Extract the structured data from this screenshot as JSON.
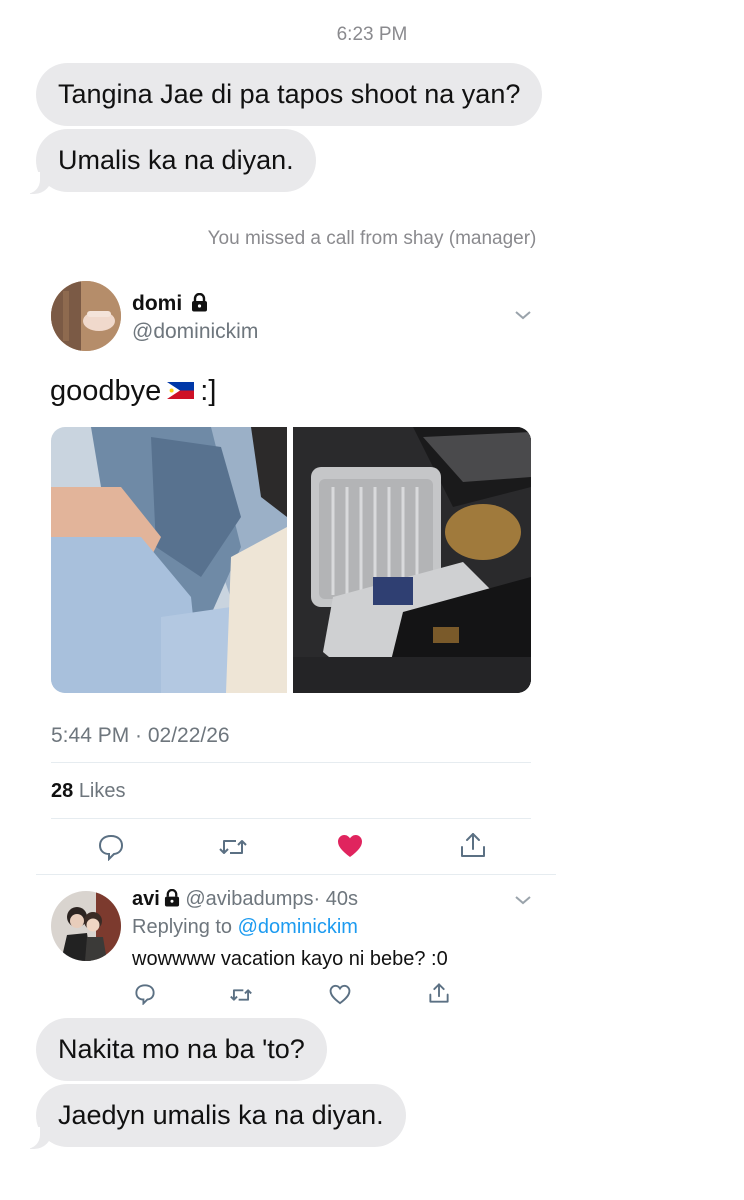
{
  "thread_top": {
    "time": "6:23 PM",
    "messages": [
      "Tangina Jae di pa tapos shoot na yan?",
      "Umalis ka na diyan."
    ],
    "missed_call": "You missed a call from shay (manager)"
  },
  "tweet": {
    "display_name": "domi",
    "handle": "@dominickim",
    "text": "goodbye",
    "text_after_flag": ":]",
    "flag_icon": "philippines-flag-icon",
    "datetime": "5:44 PM · 02/22/26",
    "likes_count": "28",
    "likes_label": "Likes",
    "liked": true,
    "like_color": "#e0245e"
  },
  "reply": {
    "display_name": "avi",
    "handle": "@avibadumps",
    "age": "· 40s",
    "replying_prefix": "Replying to",
    "replying_handle": "@dominickim",
    "text": "wowwww vacation kayo ni bebe? :0"
  },
  "thread_bottom": {
    "messages": [
      "Nakita mo na ba 'to?",
      "Jaedyn umalis ka na diyan."
    ]
  },
  "colors": {
    "bubble": "#e9e9eb",
    "muted": "#8a8a8e",
    "link": "#1d9bf0"
  }
}
